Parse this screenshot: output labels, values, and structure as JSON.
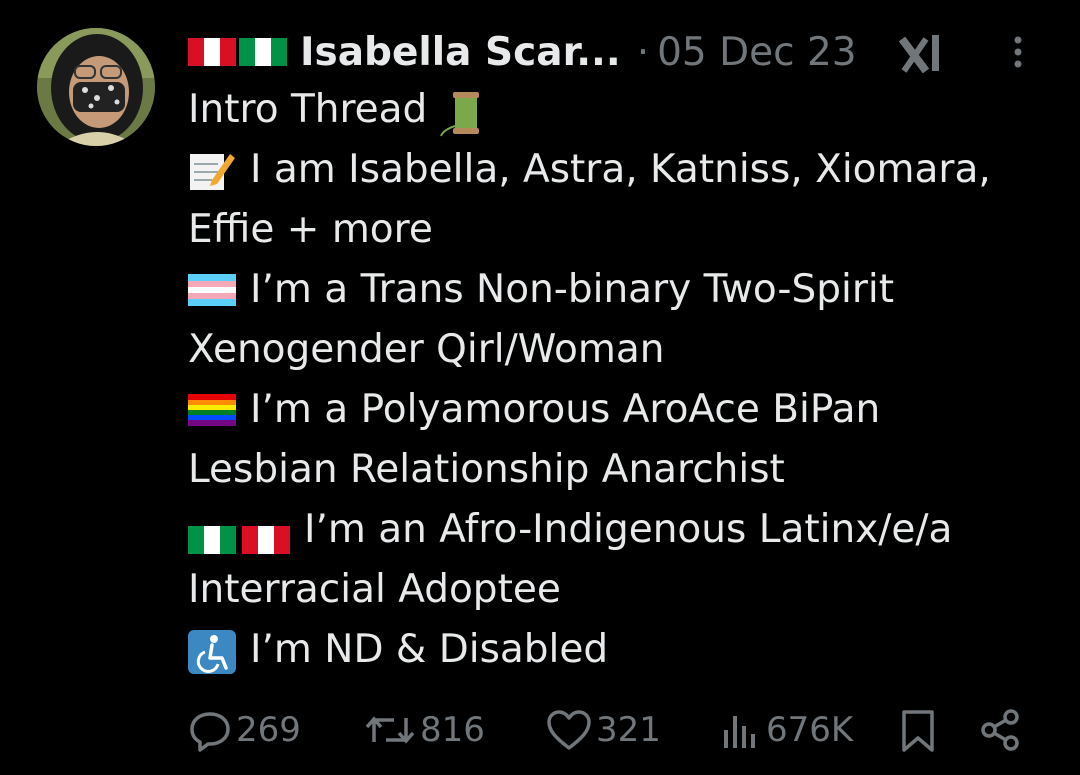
{
  "post": {
    "author": "Isabella Scar...",
    "separator": "·",
    "date": "05 Dec 23",
    "lines": [
      "Intro Thread",
      "I am Isabella, Astra, Katniss, Xiomara,",
      "Effie + more",
      "I’m a Trans Non-binary Two-Spirit",
      "Xenogender Qirl/Woman",
      "I’m a Polyamorous AroAce BiPan",
      "Lesbian Relationship Anarchist",
      "I’m an Afro-Indigenous Latinx/e/a",
      "Interracial Adoptee",
      "I’m ND & Disabled"
    ],
    "emojis": [
      "spool-icon",
      "memo-icon",
      "trans-flag-icon",
      "rainbow-flag-icon",
      "italy-flag-icon",
      "peru-flag-icon",
      "wheelchair-icon"
    ]
  },
  "actions": {
    "replies": "269",
    "reposts": "816",
    "likes": "321",
    "views": "676K"
  },
  "colors": {
    "background": "#000000",
    "text": "#e7e9ea",
    "muted": "#71767b"
  }
}
